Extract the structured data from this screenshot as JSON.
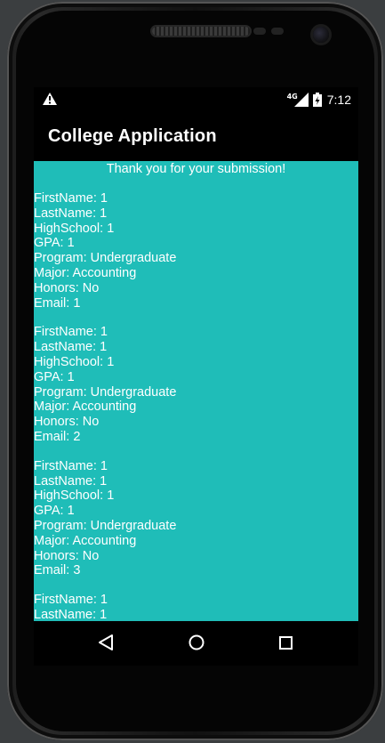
{
  "status_bar": {
    "warning_icon": "warning-icon",
    "network": "4G",
    "time": "7:12"
  },
  "app_bar": {
    "title": "College Application"
  },
  "content": {
    "message": "Thank you for your submission!",
    "records": [
      [
        "FirstName: 1",
        "LastName: 1",
        "HighSchool: 1",
        "GPA: 1",
        "Program: Undergraduate",
        "Major: Accounting",
        "Honors: No",
        "Email: 1"
      ],
      [
        "FirstName: 1",
        "LastName: 1",
        "HighSchool: 1",
        "GPA: 1",
        "Program: Undergraduate",
        "Major: Accounting",
        "Honors: No",
        "Email: 2"
      ],
      [
        "FirstName: 1",
        "LastName: 1",
        "HighSchool: 1",
        "GPA: 1",
        "Program: Undergraduate",
        "Major: Accounting",
        "Honors: No",
        "Email: 3"
      ],
      [
        "FirstName: 1",
        "LastName: 1"
      ]
    ],
    "background_color": "#1fbdb8"
  },
  "nav_bar": {
    "back_icon": "back-triangle-icon",
    "home_icon": "home-circle-icon",
    "recents_icon": "recents-square-icon"
  }
}
